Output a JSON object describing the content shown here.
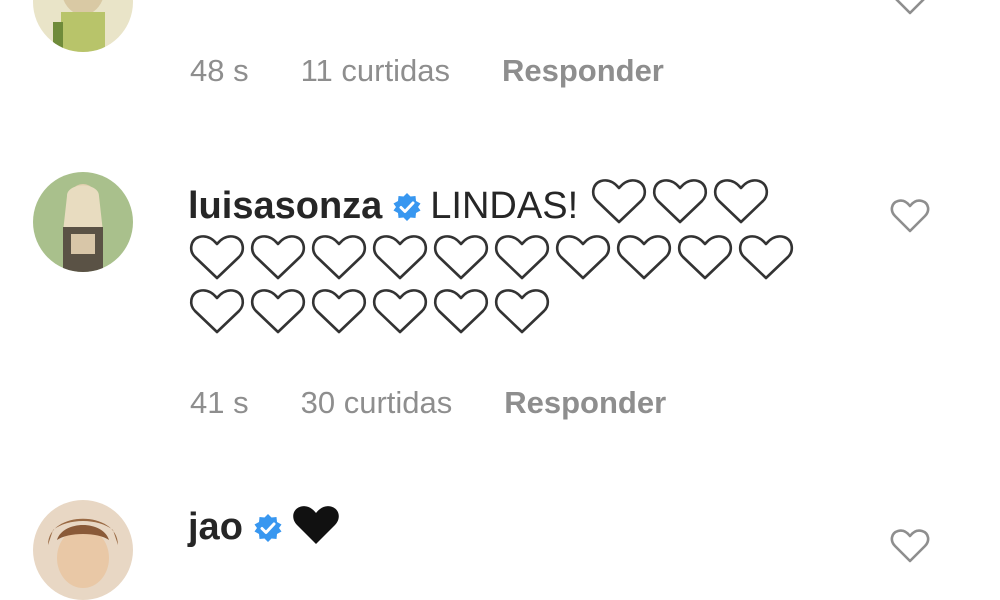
{
  "comments": [
    {
      "username": "",
      "verified": true,
      "text": "",
      "time": "48 s",
      "likes": "11 curtidas",
      "reply_label": "Responder",
      "avatar_icon": "user-avatar"
    },
    {
      "username": "luisasonza",
      "verified": true,
      "text": "LINDAS!",
      "emoji": "white-heart",
      "emoji_count": 19,
      "time": "41 s",
      "likes": "30 curtidas",
      "reply_label": "Responder",
      "avatar_icon": "user-avatar"
    },
    {
      "username": "jao",
      "verified": true,
      "emoji": "black-heart",
      "emoji_count": 1,
      "avatar_icon": "user-avatar"
    }
  ],
  "colors": {
    "verified_badge": "#3897f0",
    "meta_text": "#8e8e8e",
    "text": "#262626"
  },
  "icons": {
    "like": "heart-outline-icon",
    "verified": "verified-badge-icon"
  }
}
